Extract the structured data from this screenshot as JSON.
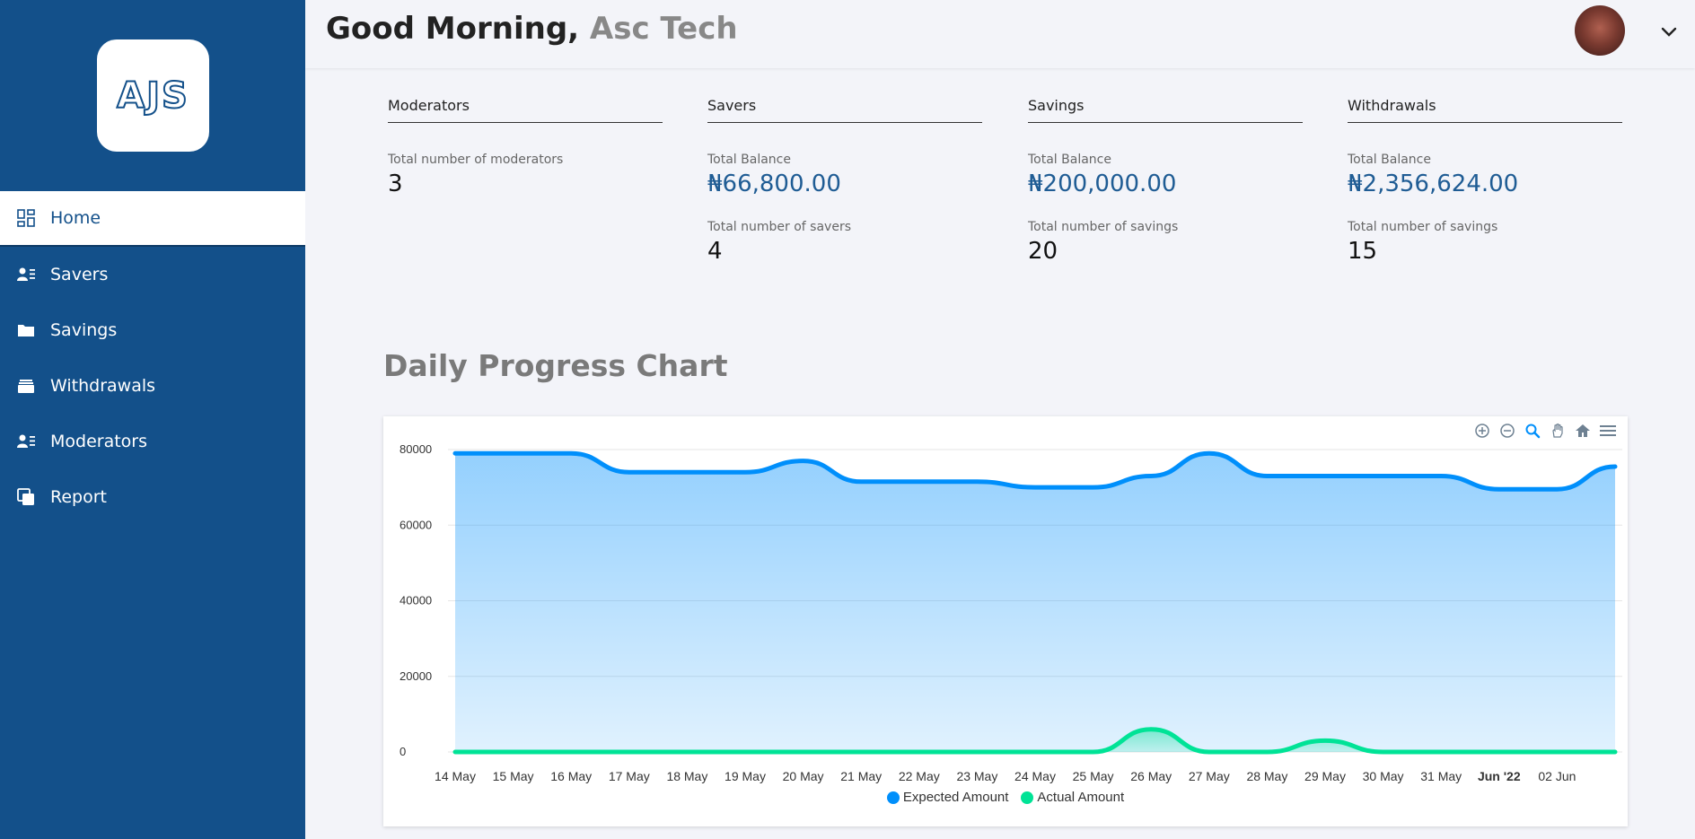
{
  "sidebar": {
    "logo": "AJS",
    "items": [
      {
        "label": "Home",
        "icon": "dashboard-icon",
        "active": true
      },
      {
        "label": "Savers",
        "icon": "users-list-icon"
      },
      {
        "label": "Savings",
        "icon": "folder-icon"
      },
      {
        "label": "Withdrawals",
        "icon": "wallet-icon"
      },
      {
        "label": "Moderators",
        "icon": "users-list-icon"
      },
      {
        "label": "Report",
        "icon": "copy-icon"
      }
    ]
  },
  "header": {
    "greeting": "Good Morning,",
    "name": "Asc Tech"
  },
  "stats": {
    "moderators": {
      "title": "Moderators",
      "label1": "Total number of moderators",
      "value1": "3"
    },
    "savers": {
      "title": "Savers",
      "label1": "Total Balance",
      "value1": "₦66,800.00",
      "label2": "Total number of savers",
      "value2": "4"
    },
    "savings": {
      "title": "Savings",
      "label1": "Total Balance",
      "value1": "₦200,000.00",
      "label2": "Total number of savings",
      "value2": "20"
    },
    "withdrawals": {
      "title": "Withdrawals",
      "label1": "Total Balance",
      "value1": "₦2,356,624.00",
      "label2": "Total number of savings",
      "value2": "15"
    }
  },
  "section_title": "Daily Progress Chart",
  "colors": {
    "sidebar": "#13508a",
    "expected": "#008ffb",
    "actual": "#00e396"
  },
  "chart_data": {
    "type": "area",
    "categories": [
      "14 May",
      "15 May",
      "16 May",
      "17 May",
      "18 May",
      "19 May",
      "20 May",
      "21 May",
      "22 May",
      "23 May",
      "24 May",
      "25 May",
      "26 May",
      "27 May",
      "28 May",
      "29 May",
      "30 May",
      "31 May",
      "Jun '22",
      "02 Jun",
      ""
    ],
    "y_ticks": [
      "80000",
      "60000",
      "40000",
      "20000",
      "0"
    ],
    "ylim": [
      0,
      80000
    ],
    "series": [
      {
        "name": "Expected Amount",
        "values": [
          79000,
          79000,
          79000,
          74000,
          74000,
          74000,
          77000,
          71500,
          71500,
          71500,
          70000,
          70000,
          73000,
          79000,
          73000,
          73000,
          73000,
          73000,
          69500,
          69500,
          75500
        ]
      },
      {
        "name": "Actual Amount",
        "values": [
          0,
          0,
          0,
          0,
          0,
          0,
          0,
          0,
          0,
          0,
          0,
          0,
          6000,
          0,
          0,
          3000,
          0,
          0,
          0,
          0,
          0
        ]
      }
    ],
    "legend": "bottom-center"
  }
}
